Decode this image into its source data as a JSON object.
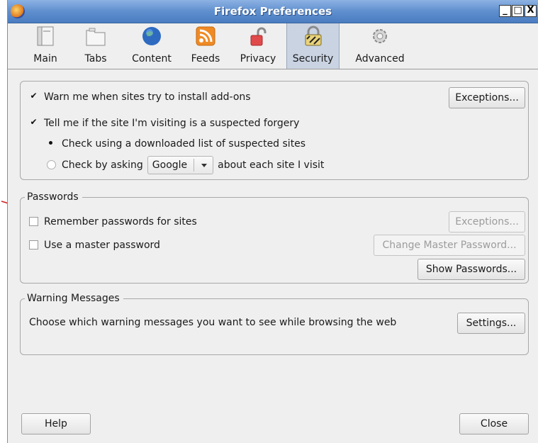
{
  "window": {
    "title": "Firefox Preferences",
    "controls": {
      "minimize": "_",
      "maximize": "□",
      "close": "X"
    }
  },
  "toolbar": {
    "items": [
      {
        "label": "Main",
        "icon": "main-icon"
      },
      {
        "label": "Tabs",
        "icon": "tabs-icon"
      },
      {
        "label": "Content",
        "icon": "content-icon"
      },
      {
        "label": "Feeds",
        "icon": "feeds-icon"
      },
      {
        "label": "Privacy",
        "icon": "privacy-icon"
      },
      {
        "label": "Security",
        "icon": "security-icon",
        "active": true
      },
      {
        "label": "Advanced",
        "icon": "advanced-icon"
      }
    ]
  },
  "general": {
    "warn_addons": {
      "label": "Warn me when sites try to install add-ons",
      "checked": true
    },
    "exceptions_label": "Exceptions...",
    "forgery": {
      "label": "Tell me if the site I'm visiting is a suspected forgery",
      "checked": true
    },
    "radio_download": {
      "label": "Check using a downloaded list of suspected sites",
      "selected": true
    },
    "radio_ask": {
      "label_before": "Check by asking",
      "provider": "Google",
      "label_after": "about each site I visit",
      "selected": false
    }
  },
  "passwords": {
    "legend": "Passwords",
    "remember": {
      "label": "Remember passwords for sites",
      "checked": false
    },
    "exceptions_label": "Exceptions...",
    "master": {
      "label": "Use a master password",
      "checked": false
    },
    "change_master_label": "Change Master Password...",
    "show_passwords_label": "Show Passwords..."
  },
  "warnings": {
    "legend": "Warning Messages",
    "text": "Choose which warning messages you want to see while browsing the web",
    "settings_label": "Settings..."
  },
  "footer": {
    "help_label": "Help",
    "close_label": "Close"
  },
  "colors": {
    "titlebar": "#5f8fce",
    "active_tab": "#c9d3e2",
    "annotation_arrow": "#d11a1a"
  }
}
